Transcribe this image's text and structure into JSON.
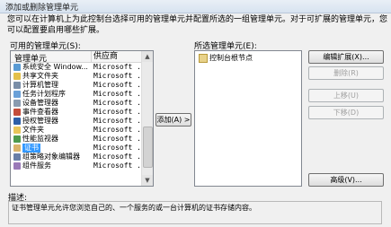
{
  "window": {
    "title": "添加或删除管理单元"
  },
  "intro_text": "您可以在计算机上为此控制台选择可用的管理单元并配置所选的一组管理单元。对于可扩展的管理单元，您可以配置要启用哪些扩展。",
  "available": {
    "label": "可用的管理单元(S):",
    "col_snapin": "管理单元",
    "col_vendor": "供应商",
    "items": [
      {
        "name": "系统安全 Window...",
        "vendor": "Microsoft ...",
        "color": "#5a9bd4"
      },
      {
        "name": "共享文件夹",
        "vendor": "Microsoft ...",
        "color": "#e3c04a"
      },
      {
        "name": "计算机管理",
        "vendor": "Microsoft ...",
        "color": "#7a8ea8"
      },
      {
        "name": "任务计划程序",
        "vendor": "Microsoft ...",
        "color": "#6aa0d8"
      },
      {
        "name": "设备管理器",
        "vendor": "Microsoft ...",
        "color": "#8a9bb0"
      },
      {
        "name": "事件查看器",
        "vendor": "Microsoft ...",
        "color": "#c44d3a"
      },
      {
        "name": "授权管理器",
        "vendor": "Microsoft ...",
        "color": "#2d5fa8"
      },
      {
        "name": "文件夹",
        "vendor": "Microsoft ...",
        "color": "#e8c55a"
      },
      {
        "name": "性能监视器",
        "vendor": "Microsoft ...",
        "color": "#4e9a4e"
      },
      {
        "name": "证书",
        "vendor": "Microsoft ...",
        "color": "#d9b36a",
        "selected": true
      },
      {
        "name": "组策略对象编辑器",
        "vendor": "Microsoft ...",
        "color": "#6a7fa8"
      },
      {
        "name": "组件服务",
        "vendor": "Microsoft ...",
        "color": "#9a7ab8"
      }
    ]
  },
  "add_button": "添加(A) >",
  "selected": {
    "label": "所选管理单元(E):",
    "items": [
      {
        "name": "控制台根节点"
      }
    ]
  },
  "buttons": {
    "edit_extensions": "编辑扩展(X)...",
    "remove": "删除(R)",
    "move_up": "上移(U)",
    "move_down": "下移(D)",
    "advanced": "高级(V)..."
  },
  "description": {
    "label": "描述:",
    "text": "证书管理单元允许您浏览自己的、一个服务的或一台计算机的证书存储内容。"
  }
}
